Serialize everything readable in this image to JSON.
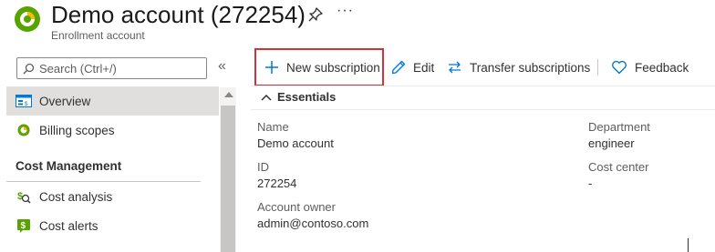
{
  "header": {
    "title": "Demo account (272254)",
    "subtitle": "Enrollment account",
    "more_label": "···"
  },
  "sidebar": {
    "search_placeholder": "Search (Ctrl+/)",
    "collapse_label": "«",
    "items": [
      {
        "label": "Overview",
        "icon": "overview-icon",
        "active": true
      },
      {
        "label": "Billing scopes",
        "icon": "billing-scopes-icon",
        "active": false
      }
    ],
    "section_title": "Cost Management",
    "section_items": [
      {
        "label": "Cost analysis",
        "icon": "cost-analysis-icon"
      },
      {
        "label": "Cost alerts",
        "icon": "cost-alerts-icon"
      }
    ]
  },
  "toolbar": {
    "new_subscription": "New subscription",
    "edit": "Edit",
    "transfer": "Transfer subscriptions",
    "feedback": "Feedback"
  },
  "essentials": {
    "title": "Essentials",
    "fields": {
      "name_label": "Name",
      "name_value": "Demo account",
      "id_label": "ID",
      "id_value": "272254",
      "owner_label": "Account owner",
      "owner_value": "admin@contoso.com",
      "department_label": "Department",
      "department_value": "engineer",
      "cost_center_label": "Cost center",
      "cost_center_value": "-"
    }
  },
  "colors": {
    "accent": "#0078d4",
    "highlight": "#d13438",
    "logo_green": "#57a300",
    "active_nav": "#e1dfdd"
  }
}
